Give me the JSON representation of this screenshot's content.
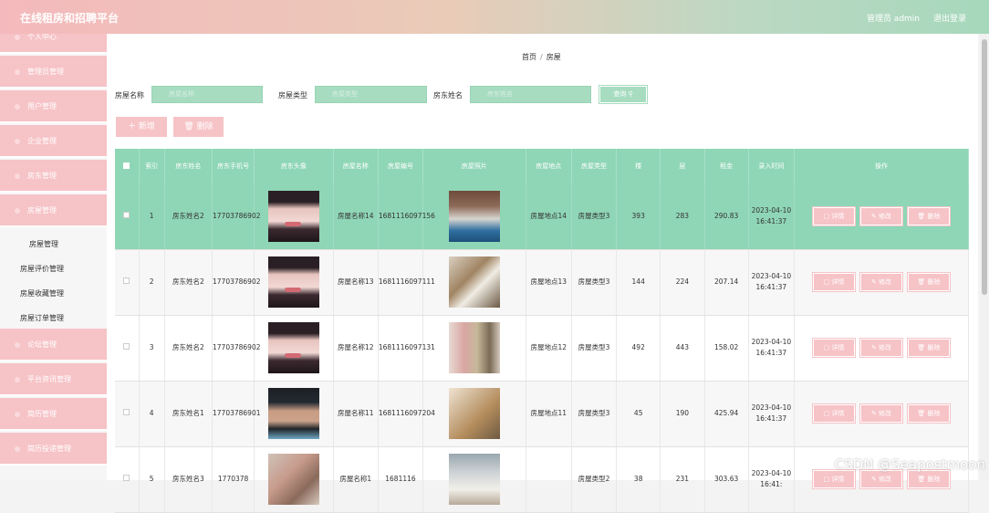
{
  "app": {
    "title": "在线租房和招聘平台",
    "admin_label": "管理员 admin",
    "logout_label": "退出登录"
  },
  "sidebar": {
    "menus": [
      {
        "label": "个人中心"
      },
      {
        "label": "管理员管理"
      },
      {
        "label": "用户管理"
      },
      {
        "label": "企业管理"
      },
      {
        "label": "房东管理"
      },
      {
        "label": "房屋管理"
      }
    ],
    "submenus": [
      {
        "label": "房屋管理"
      },
      {
        "label": "房屋评价管理"
      },
      {
        "label": "房屋收藏管理"
      },
      {
        "label": "房屋订单管理"
      }
    ],
    "menus2": [
      {
        "label": "论坛管理"
      },
      {
        "label": "平台资讯管理"
      },
      {
        "label": "简历管理"
      },
      {
        "label": "简历投递管理"
      }
    ]
  },
  "breadcrumb": {
    "home": "首页",
    "sep": "/",
    "current": "房屋"
  },
  "filters": {
    "house_name_label": "房屋名称",
    "house_name_placeholder": "房屋名称",
    "house_type_label": "房屋类型",
    "house_type_placeholder": "房屋类型",
    "landlord_label": "房东姓名",
    "landlord_placeholder": "房东姓名",
    "query_label": "查询 ⚲"
  },
  "actions": {
    "add_label": "＋ 新增",
    "delete_label": "🗑 删除"
  },
  "table": {
    "headers": [
      "索引",
      "房东姓名",
      "房东手机号",
      "房东头像",
      "房屋名称",
      "房屋编号",
      "房屋照片",
      "房屋地点",
      "房屋类型",
      "楼",
      "层",
      "租金",
      "录入时间",
      "操作"
    ],
    "op_labels": {
      "detail": "▢ 详情",
      "edit": "✎ 修改",
      "delete": "🗑 删除"
    },
    "rows": [
      {
        "index": "1",
        "landlord": "房东姓名2",
        "phone": "17703786902",
        "name": "房屋名称14",
        "code": "1681116097156",
        "location": "房屋地点14",
        "type": "房屋类型3",
        "floor_a": "393",
        "floor_b": "283",
        "rent": "290.83",
        "time": "2023-04-10 16:41:37"
      },
      {
        "index": "2",
        "landlord": "房东姓名2",
        "phone": "17703786902",
        "name": "房屋名称13",
        "code": "1681116097111",
        "location": "房屋地点13",
        "type": "房屋类型3",
        "floor_a": "144",
        "floor_b": "224",
        "rent": "207.14",
        "time": "2023-04-10 16:41:37"
      },
      {
        "index": "3",
        "landlord": "房东姓名2",
        "phone": "17703786902",
        "name": "房屋名称12",
        "code": "1681116097131",
        "location": "房屋地点12",
        "type": "房屋类型3",
        "floor_a": "492",
        "floor_b": "443",
        "rent": "158.02",
        "time": "2023-04-10 16:41:37"
      },
      {
        "index": "4",
        "landlord": "房东姓名1",
        "phone": "17703786901",
        "name": "房屋名称11",
        "code": "1681116097204",
        "location": "房屋地点11",
        "type": "房屋类型3",
        "floor_a": "45",
        "floor_b": "190",
        "rent": "425.94",
        "time": "2023-04-10 16:41:37"
      },
      {
        "index": "5",
        "landlord": "房东姓名3",
        "phone": "1770378",
        "name": "房屋名称1",
        "code": "1681116",
        "location": "",
        "type": "房屋类型2",
        "floor_a": "38",
        "floor_b": "231",
        "rent": "303.63",
        "time": "2023-04-10 16:41:"
      }
    ]
  },
  "watermark": "CSDN @Seapostmoon"
}
